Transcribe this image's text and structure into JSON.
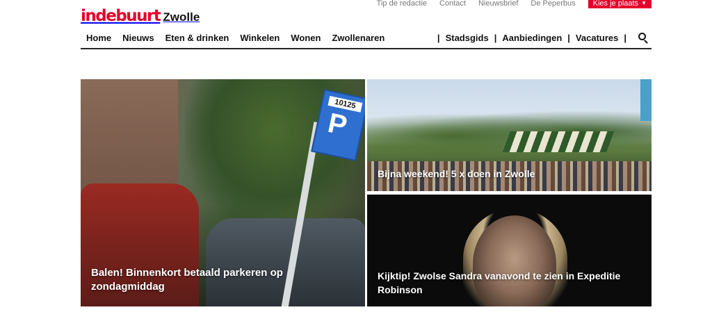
{
  "toplinks": {
    "tip": "Tip de redactie",
    "contact": "Contact",
    "nieuwsbrief": "Nieuwsbrief",
    "peperbus": "De Peperbus",
    "kies": "Kies je plaats"
  },
  "logo": {
    "brand": "indebuurt",
    "city": "Zwolle"
  },
  "nav": {
    "left": [
      "Home",
      "Nieuws",
      "Eten & drinken",
      "Winkelen",
      "Wonen",
      "Zwollenaren"
    ],
    "right": [
      "Stadsgids",
      "Aanbiedingen",
      "Vacatures"
    ],
    "separator": "|"
  },
  "articles": {
    "big": {
      "title": "Balen! Binnenkort betaald parkeren op zondagmiddag",
      "sign_number": "10125",
      "sign_letter": "P"
    },
    "top_right": {
      "title": "Bijna weekend! 5 x doen in Zwolle"
    },
    "bottom_right": {
      "title": "Kijktip! Zwolse Sandra vanavond te zien in Expeditie Robinson"
    }
  },
  "colors": {
    "brand_red": "#e4002b",
    "nav_text": "#111111",
    "toplink_text": "#777777"
  },
  "icons": {
    "search": "search-icon",
    "chevron": "chevron-down-icon"
  }
}
